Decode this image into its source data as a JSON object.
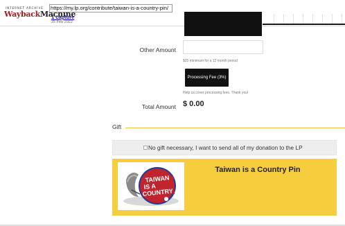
{
  "wayback": {
    "logo_top": "INTERNET ARCHIVE",
    "logo_part1": "Wayback",
    "logo_part2": "Machine",
    "url": "https://my.lp.org/contribute/taiwan-is-a-country-pin/",
    "captures": "1 capture",
    "date": "25 Feb 2022"
  },
  "form": {
    "other_amount_label": "Other Amount",
    "other_amount_value": "",
    "minimum_note": "$25 minimum for a 12 month period",
    "fee_button": "Processing Fee (3%)",
    "fee_note": "Help us cover processing fees. Thank you!",
    "total_label": "Total Amount",
    "total_value": "$ 0.00"
  },
  "gift": {
    "section_label": "Gift",
    "no_gift_text": "No gift necessary, I want to send all of my donation to the LP",
    "no_gift_checked": false,
    "card_title": "Taiwan is a Country Pin",
    "pin_text": [
      "TAIWAN",
      "IS A",
      "COUNTRY"
    ]
  },
  "colors": {
    "accent_yellow": "#f5ce3d",
    "button_black": "#111111",
    "gift_rule": "#f0c040"
  }
}
